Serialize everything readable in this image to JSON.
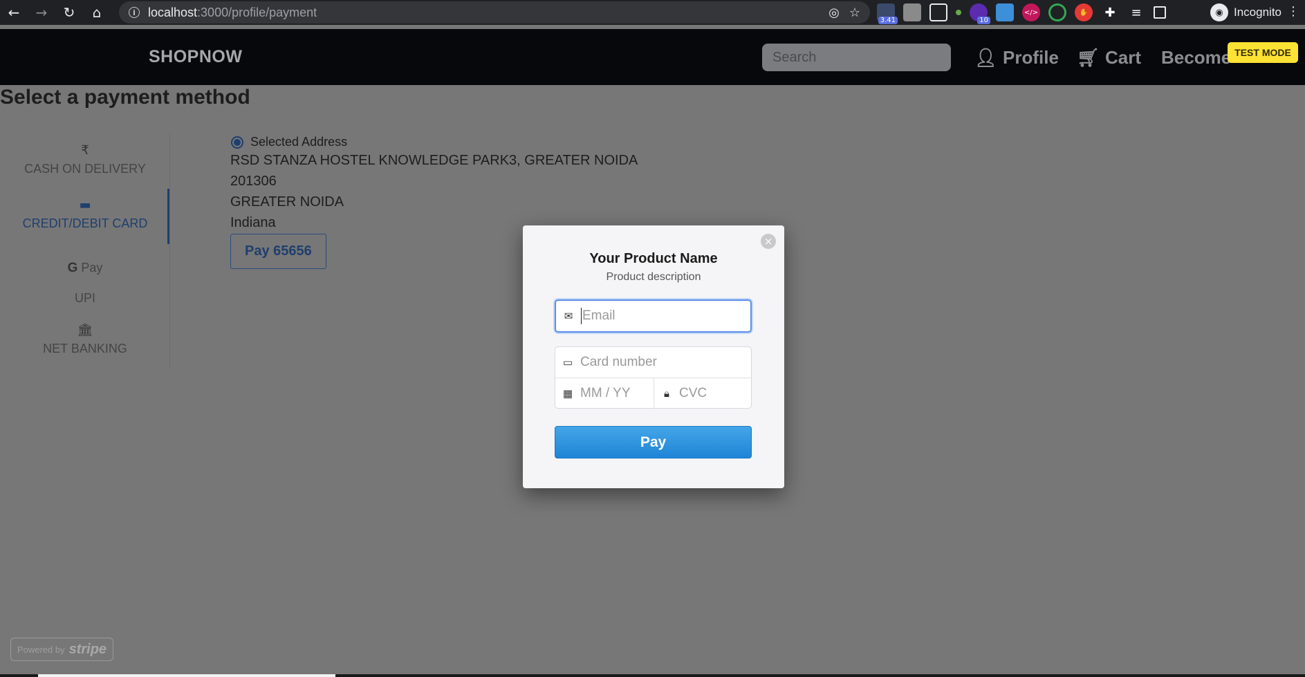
{
  "browser": {
    "url_host": "localhost",
    "url_path": ":3000/profile/payment",
    "profile_label": "Incognito",
    "extension_badges": [
      "3.41",
      "10"
    ]
  },
  "navbar": {
    "brand": "SHOPNOW",
    "search_placeholder": "Search",
    "profile_label": "Profile",
    "cart_label": "Cart",
    "become_label": "Become",
    "test_mode": "TEST MODE"
  },
  "page": {
    "title": "Select a payment method",
    "methods": [
      {
        "icon": "rupee-icon",
        "label": "CASH ON DELIVERY"
      },
      {
        "icon": "card-icon",
        "label": "CREDIT/DEBIT CARD"
      },
      {
        "icon": "gpay-icon",
        "label": "Pay"
      },
      {
        "icon": "",
        "label": "UPI"
      },
      {
        "icon": "bank-icon",
        "label": "NET BANKING"
      }
    ],
    "address": {
      "radio_label": "Selected Address",
      "line1": "RSD STANZA HOSTEL KNOWLEDGE PARK3, GREATER NOIDA",
      "line2": "201306",
      "line3": "GREATER NOIDA",
      "line4": "Indiana"
    },
    "pay_button": "Pay 65656",
    "powered_by": "Powered by",
    "stripe": "stripe"
  },
  "modal": {
    "title": "Your Product Name",
    "description": "Product description",
    "email_placeholder": "Email",
    "card_placeholder": "Card number",
    "expiry_placeholder": "MM / YY",
    "cvc_placeholder": "CVC",
    "pay_label": "Pay"
  },
  "colors": {
    "accent": "#1f84d6",
    "active_method": "#1f3f6e",
    "test_mode": "#ffe234"
  }
}
